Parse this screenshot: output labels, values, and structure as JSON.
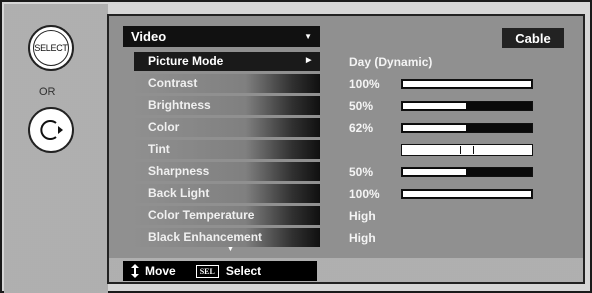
{
  "remote": {
    "select_label": "SELECT",
    "or_label": "OR",
    "select_icon": "select-button-icon",
    "dpad_icon": "dpad-right-icon"
  },
  "menu": {
    "title": "Video",
    "source": "Cable",
    "items": [
      {
        "label": "Picture Mode",
        "value": "Day (Dynamic)",
        "selected": true
      },
      {
        "label": "Contrast",
        "value": "100%",
        "level": 1.0
      },
      {
        "label": "Brightness",
        "value": "50%",
        "level": 0.5
      },
      {
        "label": "Color",
        "value": "62%",
        "level": 0.5
      },
      {
        "label": "Tint",
        "value": "",
        "level": 0.5
      },
      {
        "label": "Sharpness",
        "value": "50%",
        "level": 0.5
      },
      {
        "label": "Back Light",
        "value": "100%",
        "level": 1.0
      },
      {
        "label": "Color Temperature",
        "value": "High"
      },
      {
        "label": "Black Enhancement",
        "value": "High"
      }
    ]
  },
  "hints": {
    "move": "Move",
    "sel_icon": "SEL",
    "select": "Select"
  },
  "colors": {
    "screen_bg": "#a9a9a9",
    "menu_dark": "#111111",
    "text": "#ffffff"
  }
}
